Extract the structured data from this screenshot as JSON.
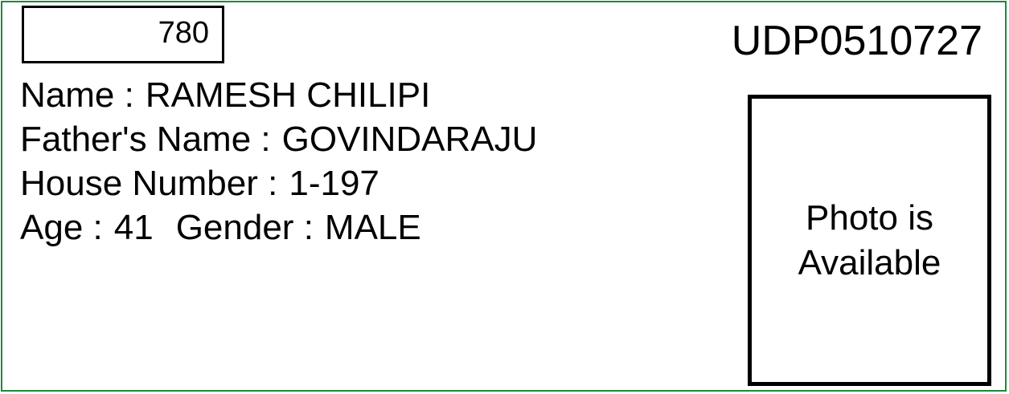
{
  "serial_number": "780",
  "epic_number": "UDP0510727",
  "fields": {
    "name_label": "Name :",
    "name_value": "RAMESH CHILIPI",
    "father_label": "Father's Name :",
    "father_value": "GOVINDARAJU",
    "house_label": "House Number :",
    "house_value": "1-197",
    "age_label": "Age :",
    "age_value": "41",
    "gender_label": "Gender :",
    "gender_value": "MALE"
  },
  "photo_text": "Photo is Available",
  "colors": {
    "border_accent": "#1c8a3c",
    "text": "#000000"
  }
}
